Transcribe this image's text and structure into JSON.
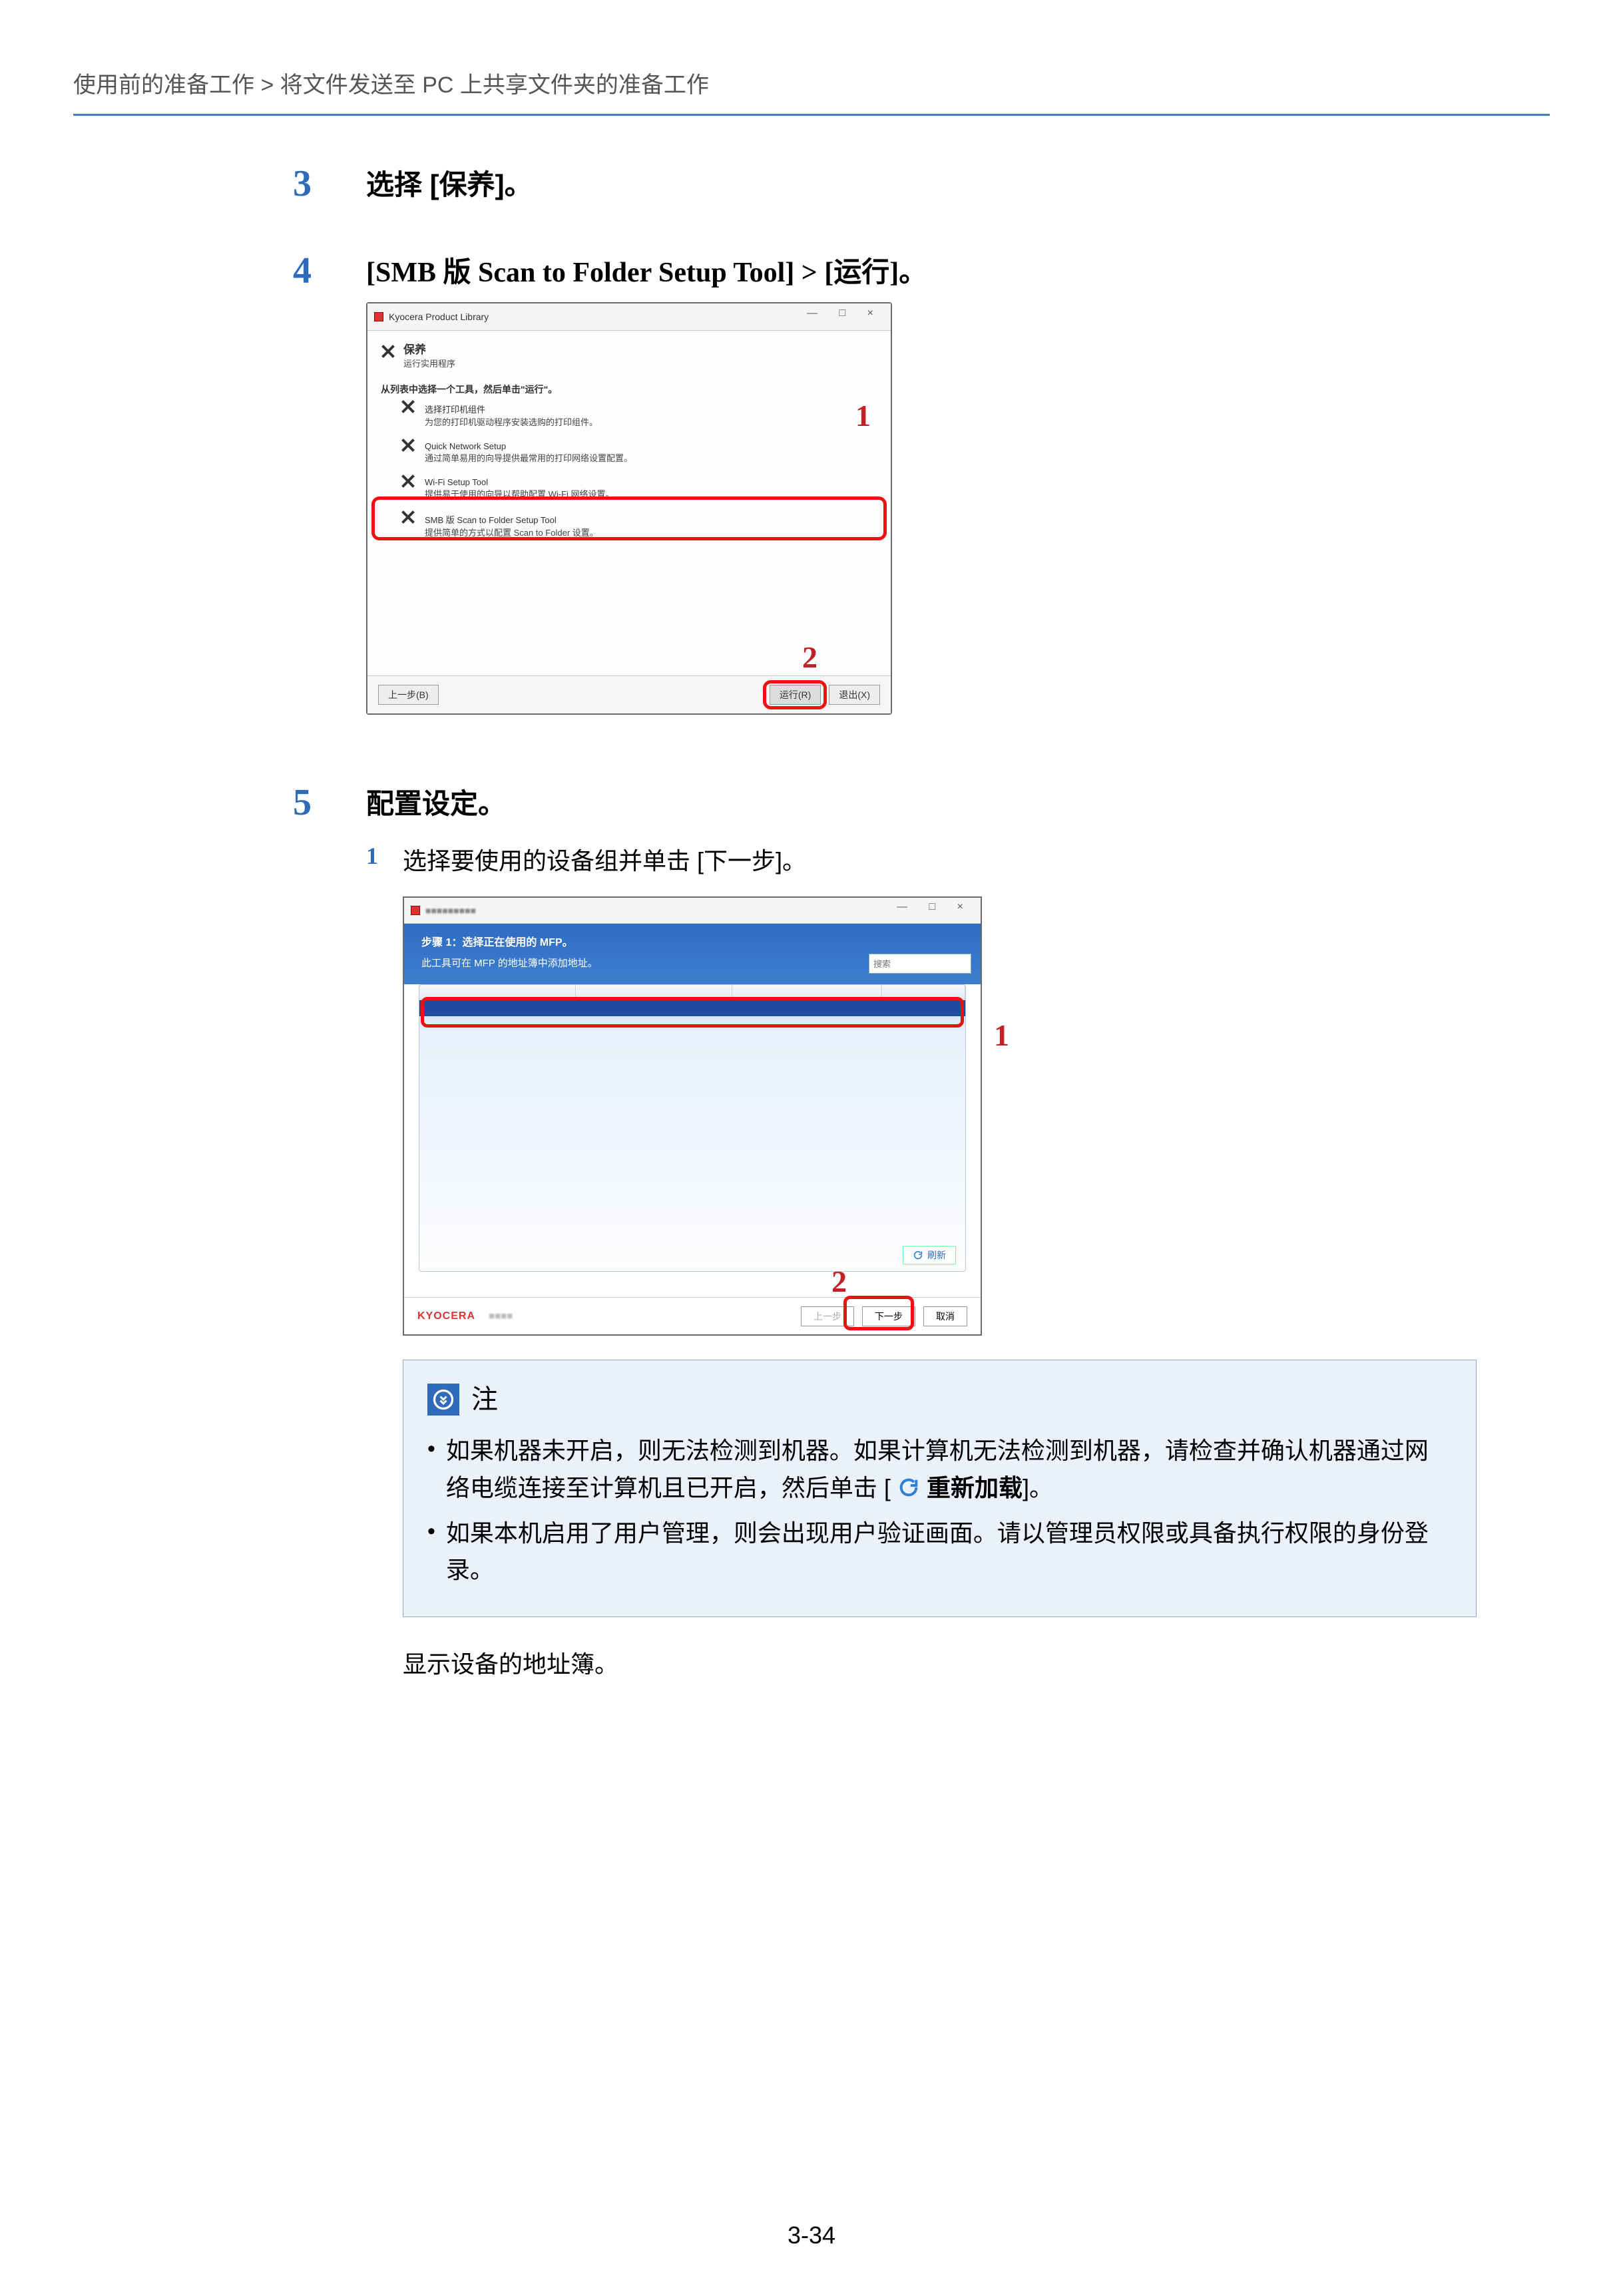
{
  "breadcrumb": "使用前的准备工作 > 将文件发送至 PC 上共享文件夹的准备工作",
  "step3": {
    "num": "3",
    "heading": "选择 [保养]。"
  },
  "step4": {
    "num": "4",
    "heading": "[SMB 版 Scan to Folder Setup Tool] > [运行]。",
    "callouts": {
      "one": "1",
      "two": "2"
    },
    "win": {
      "title": "Kyocera Product Library",
      "section_title": "保养",
      "section_sub": "运行实用程序",
      "list_intro": "从列表中选择一个工具，然后单击\"运行\"。",
      "items": [
        {
          "title": "选择打印机组件",
          "desc": "为您的打印机驱动程序安装选购的打印组件。"
        },
        {
          "title": "Quick Network Setup",
          "desc": "通过简单易用的向导提供最常用的打印网络设置配置。"
        },
        {
          "title": "Wi-Fi Setup Tool",
          "desc": "提供易于使用的向导以帮助配置 Wi-Fi 网络设置。"
        },
        {
          "title": "SMB 版 Scan to Folder Setup Tool",
          "desc": "提供简单的方式以配置 Scan to Folder 设置。"
        }
      ],
      "back": "上一步(B)",
      "run": "运行(R)",
      "exit": "退出(X)"
    }
  },
  "step5": {
    "num": "5",
    "heading": "配置设定。",
    "sub1_num": "1",
    "sub1_text": "选择要使用的设备组并单击 [下一步]。",
    "callouts": {
      "one": "1",
      "two": "2"
    },
    "win": {
      "step_title": "步骤 1：选择正在使用的 MFP。",
      "step_sub": "此工具可在 MFP 的地址簿中添加地址。",
      "search_ph": "搜索",
      "refresh": "刷新",
      "logo": "KYOCERA",
      "back": "上一步",
      "next": "下一步",
      "cancel": "取消"
    }
  },
  "note": {
    "title": "注",
    "b1a": "如果机器未开启，则无法检测到机器。如果计算机无法检测到机器，请检查并确认机器通过网络电缆连接至计算机且已开启，然后单击 [",
    "b1_reload": "重新加载",
    "b1b": "]。",
    "b2": "如果本机启用了用户管理，则会出现用户验证画面。请以管理员权限或具备执行权限的身份登录。"
  },
  "post_note": "显示设备的地址簿。",
  "page_num": "3-34"
}
